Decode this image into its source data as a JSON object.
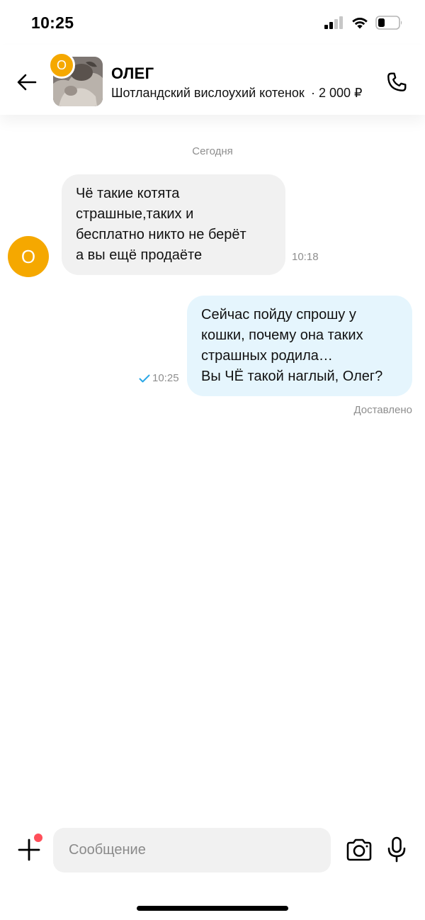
{
  "status_bar": {
    "time": "10:25",
    "icons": [
      "signal-icon",
      "wifi-icon",
      "battery-icon"
    ]
  },
  "header": {
    "contact_name": "ОЛЕГ",
    "avatar_initial": "О",
    "listing_title": "Шотландский вислоухий котенок",
    "listing_price": "· 2 000 ₽",
    "icons": [
      "arrow-left-icon",
      "phone-icon"
    ]
  },
  "chat": {
    "date_separator": "Сегодня",
    "incoming": {
      "avatar_initial": "О",
      "lines": [
        "Чё такие котята",
        "страшные,таких и",
        "бесплатно никто не берёт",
        "а вы ещё продаёте"
      ],
      "time": "10:18"
    },
    "outgoing": {
      "lines": [
        "Сейчас пойду спрошу у",
        "кошки, почему она таких",
        "страшных родила…",
        "Вы ЧЁ такой наглый, Олег?"
      ],
      "time": "10:25",
      "status": "Доставлено"
    }
  },
  "composer": {
    "placeholder": "Сообщение",
    "icons": [
      "plus-icon",
      "camera-icon",
      "microphone-icon"
    ]
  },
  "colors": {
    "avatar": "#f5a800",
    "incoming_bubble": "#f1f1f1",
    "outgoing_bubble": "#e5f5fd",
    "read_check": "#2ba7e6",
    "notification_dot": "#ff4f5a"
  }
}
